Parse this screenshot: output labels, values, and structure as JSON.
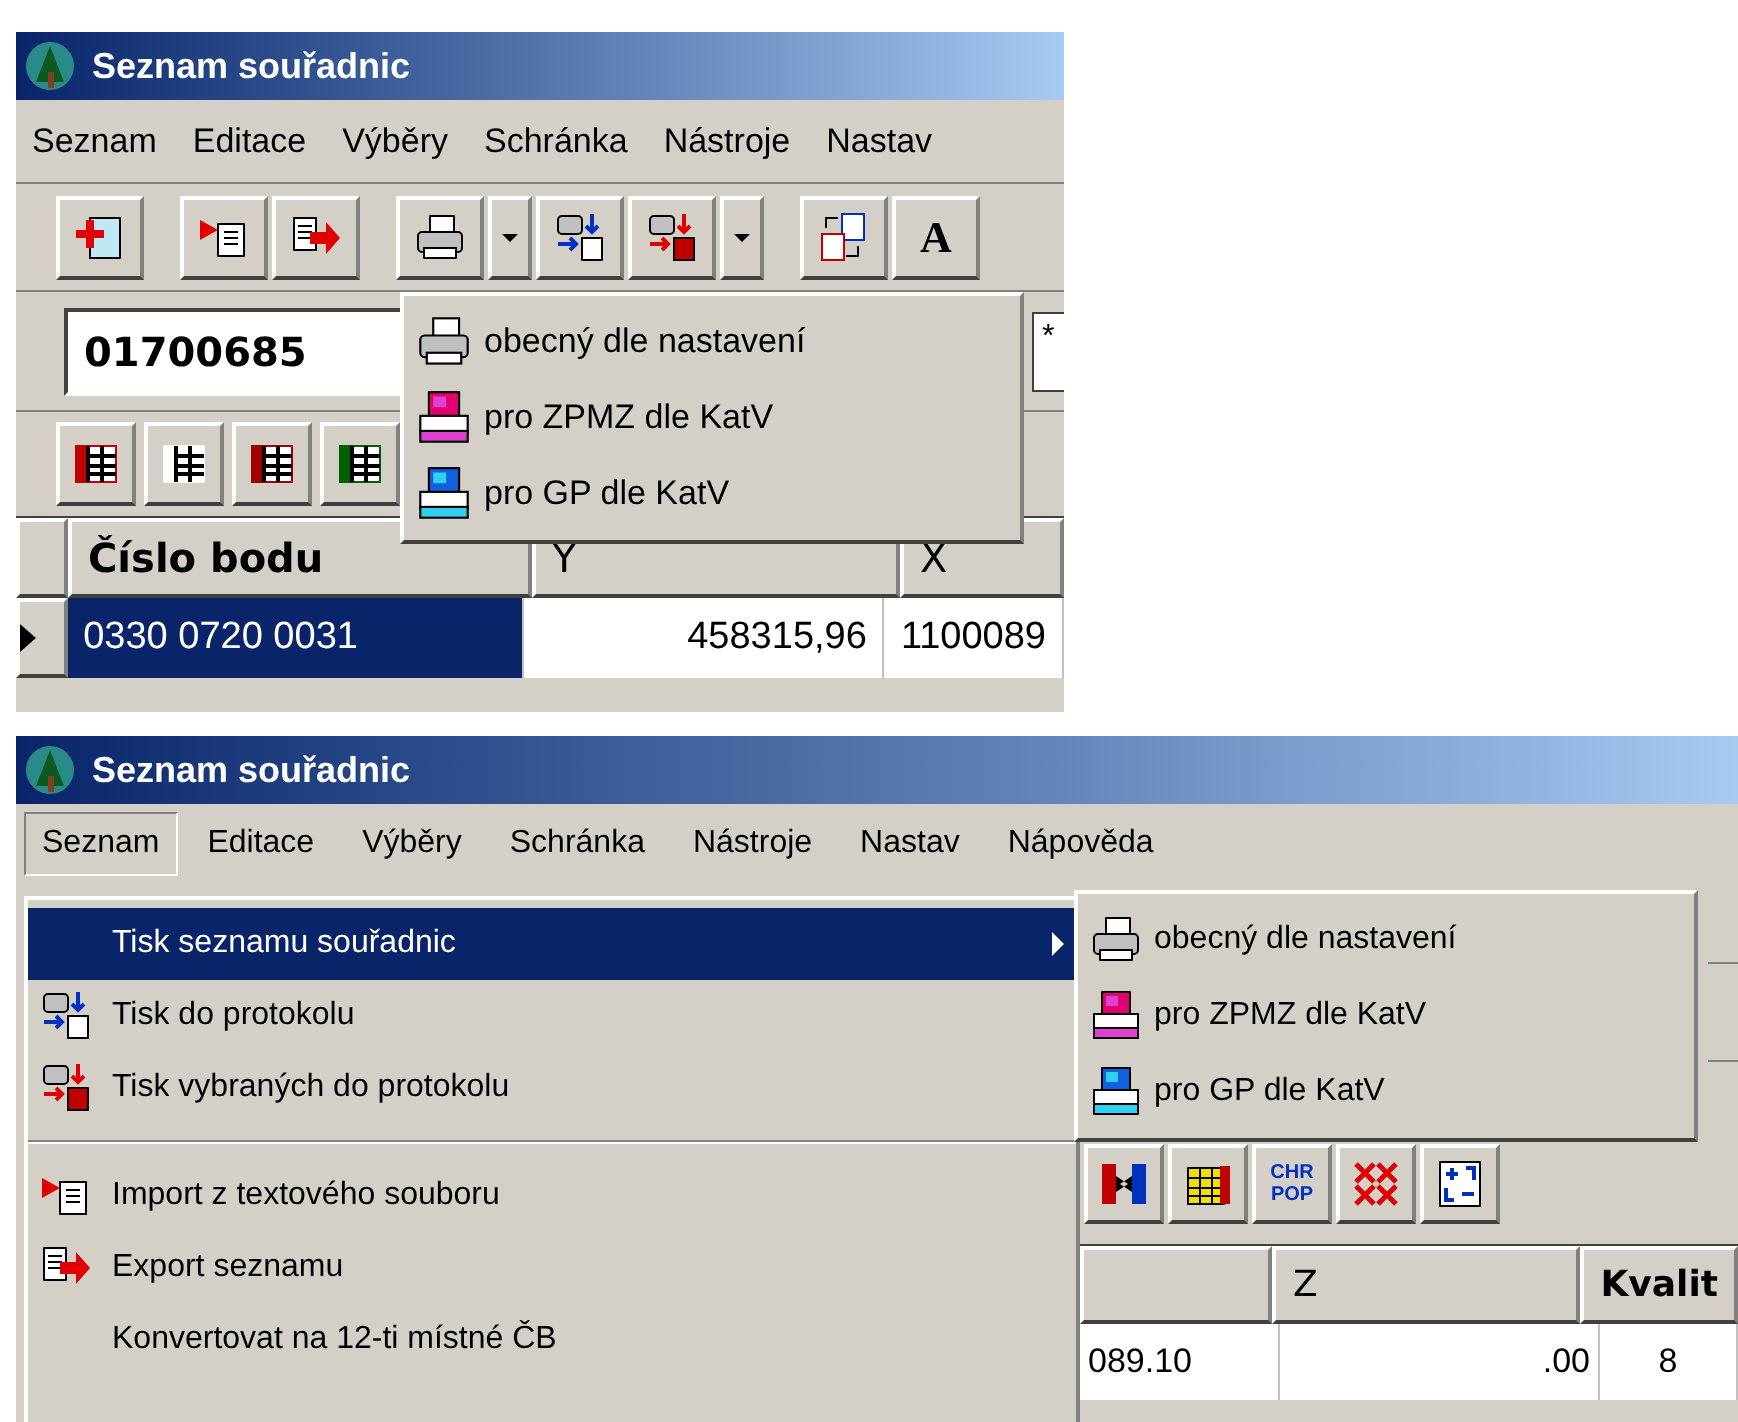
{
  "top": {
    "title": "Seznam souřadnic",
    "menu": [
      "Seznam",
      "Editace",
      "Výběry",
      "Schránka",
      "Nástroje",
      "Nastav"
    ],
    "toolbar": [
      {
        "kind": "add"
      },
      {
        "kind": "gap"
      },
      {
        "kind": "import"
      },
      {
        "kind": "export"
      },
      {
        "kind": "gap"
      },
      {
        "kind": "print"
      },
      {
        "kind": "dropdown"
      },
      {
        "kind": "print-protocol"
      },
      {
        "kind": "print-selected"
      },
      {
        "kind": "dropdown"
      },
      {
        "kind": "gap"
      },
      {
        "kind": "swap"
      },
      {
        "kind": "letter",
        "label": "A"
      }
    ],
    "point_field": {
      "value": "01700685"
    },
    "filter_field": {
      "value": "*"
    },
    "grid_tools": [
      {
        "kind": "grid",
        "color": "#c00000"
      },
      {
        "kind": "grid",
        "color": "#ffffff"
      },
      {
        "kind": "grid",
        "color": "#a00000"
      },
      {
        "kind": "grid",
        "color": "#006000"
      }
    ],
    "print_menu": [
      {
        "label": "obecný dle nastavení",
        "kind": "printer"
      },
      {
        "label": "pro ZPMZ dle KatV",
        "kind": "printer-magenta"
      },
      {
        "label": "pro GP dle KatV",
        "kind": "printer-cyan"
      }
    ],
    "table": {
      "columns": [
        "Číslo bodu",
        "Y",
        "X"
      ],
      "rows": [
        {
          "cells": [
            "0330 0720 0031",
            "458315,96",
            "1100089"
          ],
          "selected": true
        }
      ]
    }
  },
  "bottom": {
    "title": "Seznam souřadnic",
    "menu": [
      {
        "label": "Seznam",
        "selected": true
      },
      {
        "label": "Editace",
        "selected": false
      },
      {
        "label": "Výběry",
        "selected": false
      },
      {
        "label": "Schránka",
        "selected": false
      },
      {
        "label": "Nástroje",
        "selected": false
      },
      {
        "label": "Nastav",
        "selected": false
      },
      {
        "label": "Nápověda",
        "selected": false
      }
    ],
    "seznam_menu": [
      {
        "kind": "submenu",
        "label": "Tisk seznamu souřadnic",
        "selected": true
      },
      {
        "kind": "print-protocol",
        "label": "Tisk do protokolu",
        "selected": false
      },
      {
        "kind": "print-selected",
        "label": "Tisk vybraných do protokolu",
        "selected": false
      },
      {
        "kind": "separator"
      },
      {
        "kind": "import",
        "label": "Import z textového souboru",
        "selected": false
      },
      {
        "kind": "export",
        "label": "Export seznamu",
        "selected": false
      },
      {
        "kind": "plain",
        "label": "Konvertovat na 12-ti místné ČB",
        "selected": false
      }
    ],
    "submenu": [
      {
        "label": "obecný dle nastavení",
        "kind": "printer"
      },
      {
        "label": "pro ZPMZ dle KatV",
        "kind": "printer-magenta"
      },
      {
        "label": "pro GP dle KatV",
        "kind": "printer-cyan"
      }
    ],
    "toolbar": [
      {
        "kind": "swap-columns"
      },
      {
        "kind": "grid-yellow"
      },
      {
        "kind": "letters",
        "lines": [
          "CHR",
          "POP"
        ]
      },
      {
        "kind": "cross"
      },
      {
        "kind": "plus-minus"
      }
    ],
    "table": {
      "columns": [
        "",
        "Z",
        "Kvalit"
      ],
      "rows": [
        {
          "cells": [
            "089.10",
            ".00",
            "8"
          ]
        }
      ]
    }
  }
}
